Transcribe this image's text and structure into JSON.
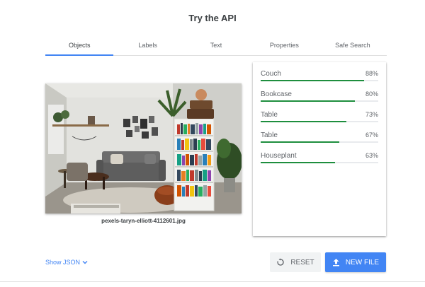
{
  "page": {
    "title": "Try the API"
  },
  "tabs": [
    {
      "label": "Objects",
      "active": true
    },
    {
      "label": "Labels",
      "active": false
    },
    {
      "label": "Text",
      "active": false
    },
    {
      "label": "Properties",
      "active": false
    },
    {
      "label": "Safe Search",
      "active": false
    }
  ],
  "image": {
    "filename": "pexels-taryn-elliott-4112601.jpg"
  },
  "results": [
    {
      "label": "Couch",
      "value": "88%",
      "score": 0.88
    },
    {
      "label": "Bookcase",
      "value": "80%",
      "score": 0.8
    },
    {
      "label": "Table",
      "value": "73%",
      "score": 0.73
    },
    {
      "label": "Table",
      "value": "67%",
      "score": 0.67
    },
    {
      "label": "Houseplant",
      "value": "63%",
      "score": 0.63
    }
  ],
  "actions": {
    "show_json": "Show JSON",
    "reset": "RESET",
    "new_file": "NEW FILE"
  },
  "icons": {
    "show_json": "chevron-down-icon",
    "reset": "reset-icon",
    "new_file": "upload-icon"
  },
  "colors": {
    "accent": "#4285f4",
    "bar": "#1e8e3e",
    "bar_track": "#e8eaed"
  }
}
